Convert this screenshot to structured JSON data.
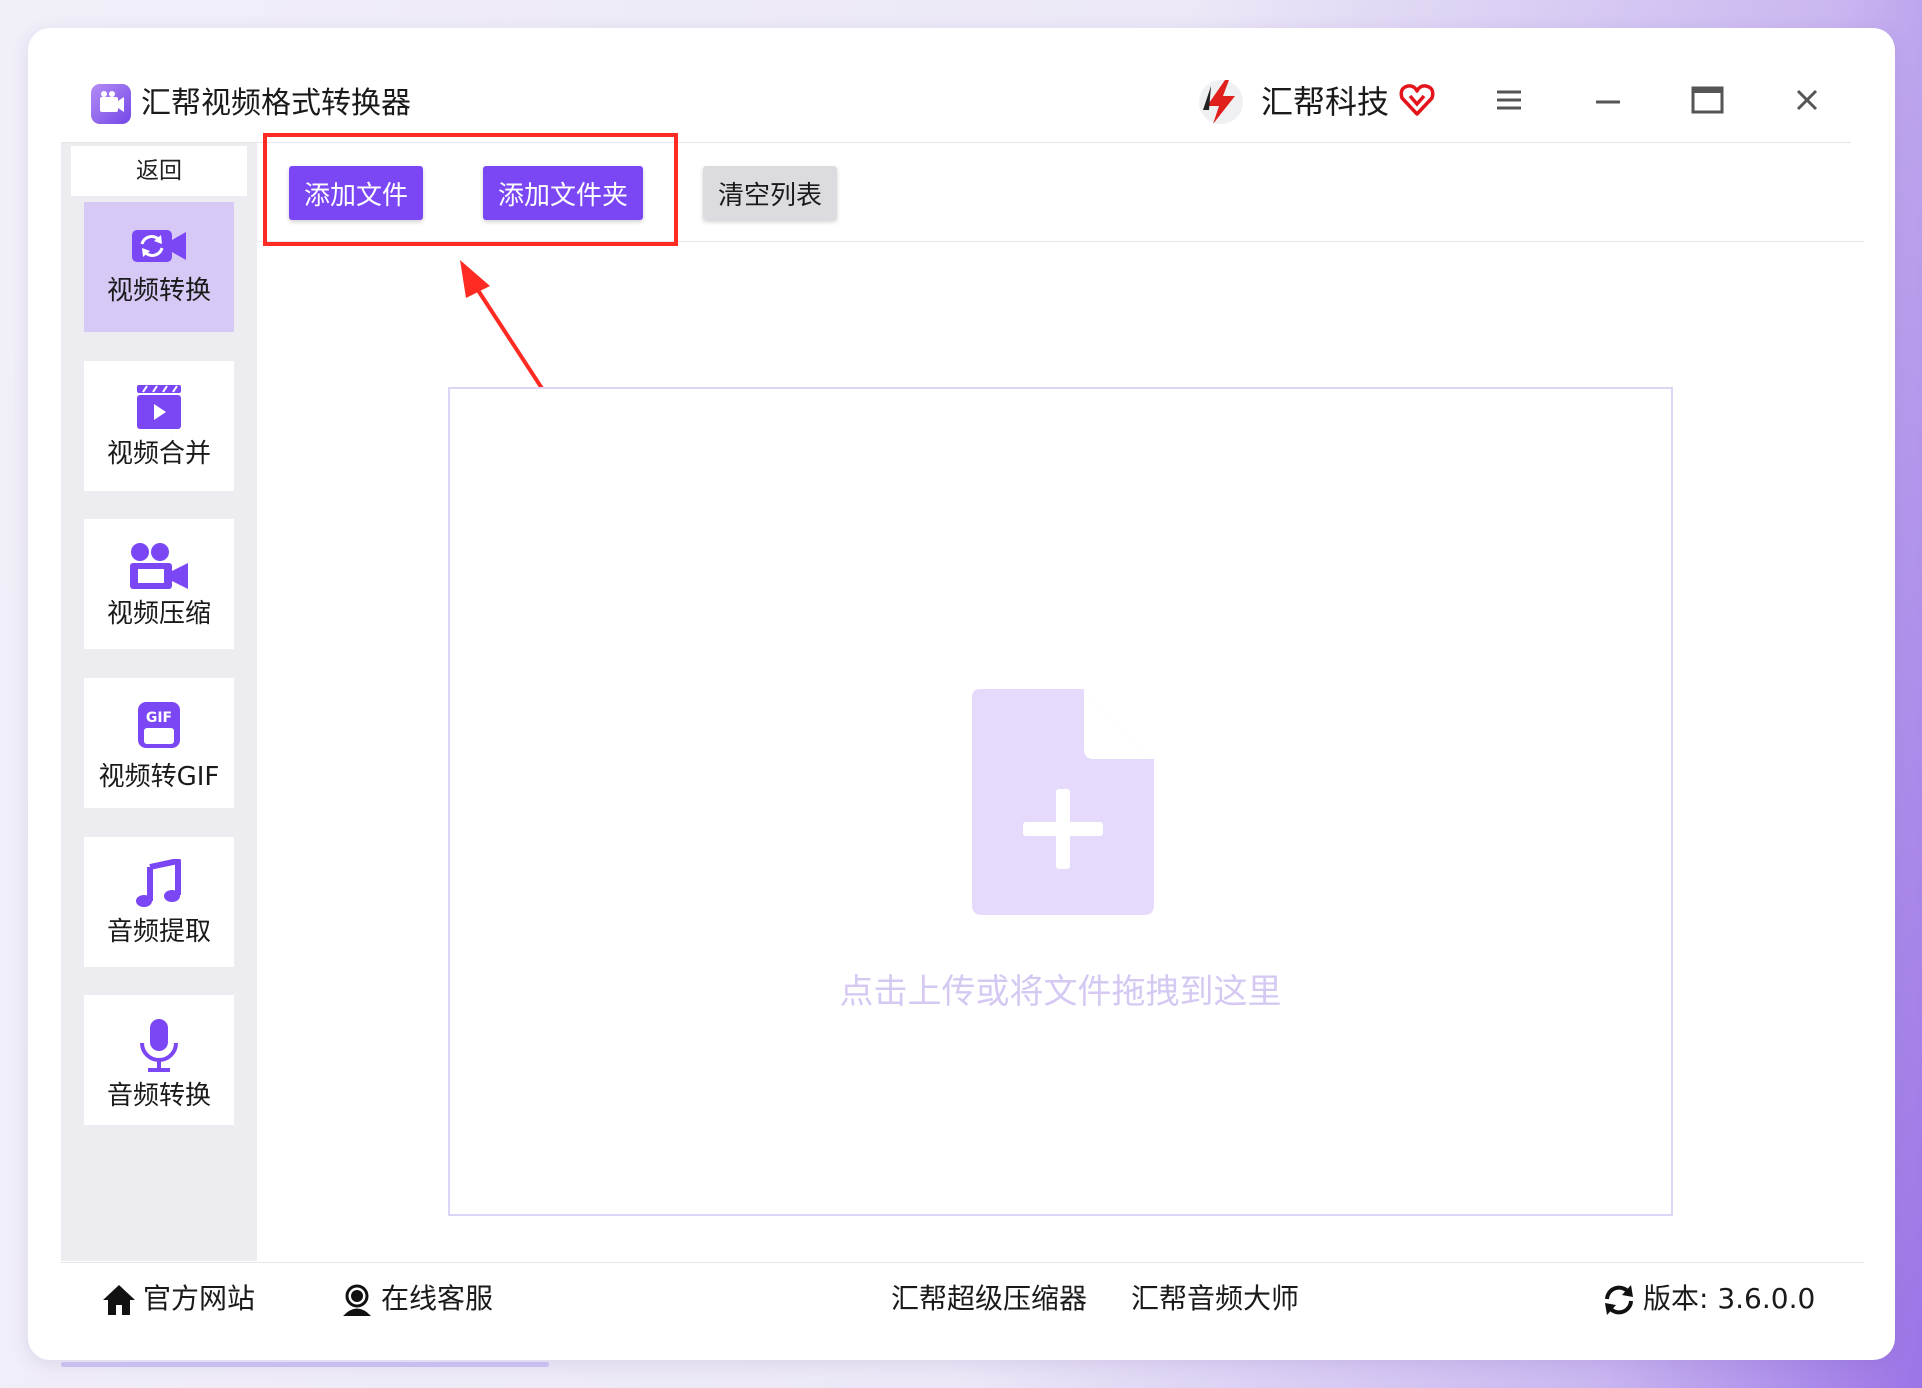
{
  "app": {
    "title": "汇帮视频格式转换器",
    "brand": "汇帮科技",
    "accent_color": "#7b47f5"
  },
  "window_controls": {
    "menu_icon": "hamburger-menu-icon",
    "minimize_icon": "minimize-icon",
    "maximize_icon": "maximize-icon",
    "close_icon": "close-icon"
  },
  "sidebar": {
    "back_label": "返回",
    "items": [
      {
        "label": "视频转换",
        "icon": "video-convert-icon",
        "active": true
      },
      {
        "label": "视频合并",
        "icon": "video-merge-icon",
        "active": false
      },
      {
        "label": "视频压缩",
        "icon": "video-compress-icon",
        "active": false
      },
      {
        "label": "视频转GIF",
        "icon": "gif-icon",
        "active": false
      },
      {
        "label": "音频提取",
        "icon": "music-note-icon",
        "active": false
      },
      {
        "label": "音频转换",
        "icon": "microphone-icon",
        "active": false
      }
    ]
  },
  "toolbar": {
    "add_file_label": "添加文件",
    "add_folder_label": "添加文件夹",
    "clear_list_label": "清空列表"
  },
  "dropzone": {
    "hint": "点击上传或将文件拖拽到这里",
    "icon": "file-add-icon"
  },
  "footer": {
    "website_label": "官方网站",
    "support_label": "在线客服",
    "link1_label": "汇帮超级压缩器",
    "link2_label": "汇帮音频大师",
    "version_label": "版本: 3.6.0.0"
  }
}
